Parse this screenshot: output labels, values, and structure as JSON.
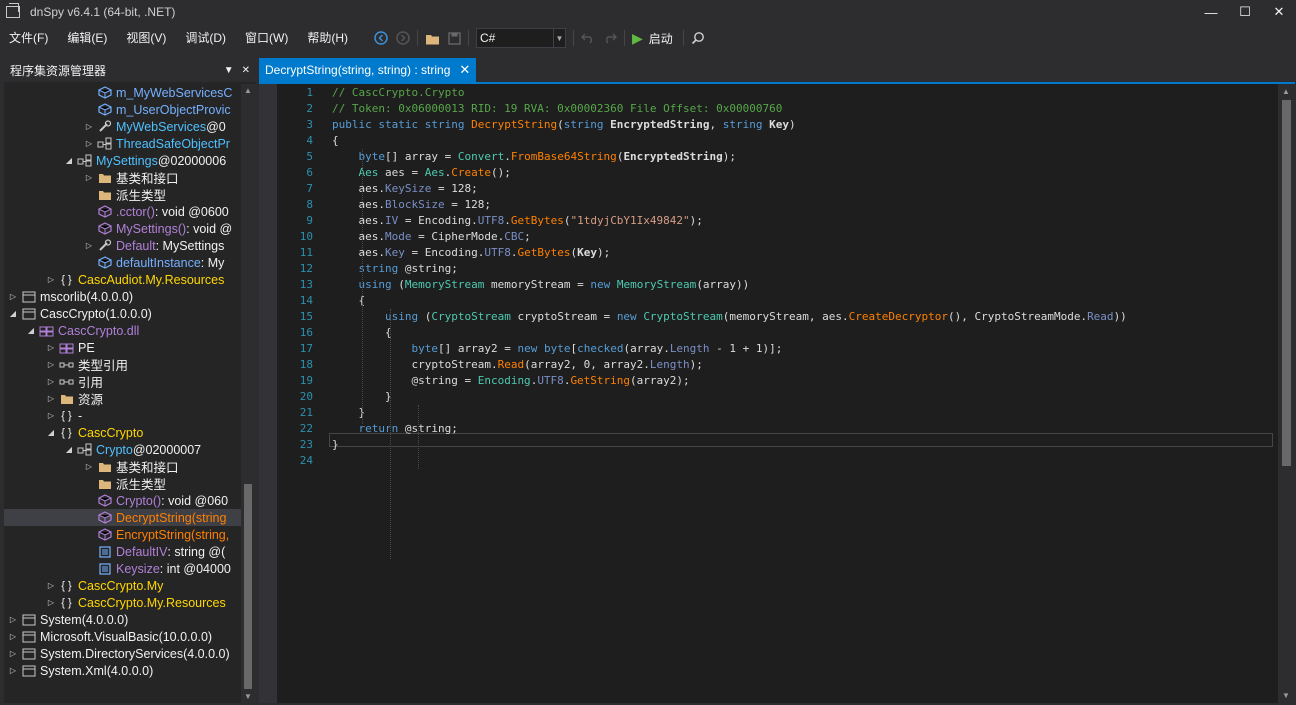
{
  "window": {
    "title": "dnSpy v6.4.1 (64-bit, .NET)",
    "minimize": "—",
    "maximize": "☐",
    "close": "✕"
  },
  "menu": [
    "文件(F)",
    "编辑(E)",
    "视图(V)",
    "调试(D)",
    "窗口(W)",
    "帮助(H)"
  ],
  "toolbar": {
    "language": "C#",
    "start_label": "启动"
  },
  "explorer": {
    "title": "程序集资源管理器",
    "rows": [
      {
        "label": "m_MyWebServicesC",
        "suffix": "",
        "color": "#75b0ff"
      },
      {
        "label": "m_UserObjectProvic",
        "suffix": "",
        "color": "#75b0ff"
      },
      {
        "label": "MyWebServices",
        "suffix": " @0",
        "color": "#4fc1ff"
      },
      {
        "label": "ThreadSafeObjectPr",
        "suffix": "",
        "color": "#4fc1ff"
      },
      {
        "label": "MySettings",
        "suffix": " @02000006",
        "color": "#4fc1ff"
      },
      {
        "label": "基类和接口",
        "suffix": "",
        "color": "#f1f1f1"
      },
      {
        "label": "派生类型",
        "suffix": "",
        "color": "#f1f1f1"
      },
      {
        "label": ".cctor()",
        "suffix": " : void @0600",
        "color": "#b180d7"
      },
      {
        "label": "MySettings()",
        "suffix": " : void @",
        "color": "#b180d7"
      },
      {
        "label": "Default",
        "suffix": " : MySettings",
        "color": "#b180d7"
      },
      {
        "label": "defaultInstance",
        "suffix": " : My",
        "color": "#75b0ff"
      },
      {
        "label": "CascAudiot.My.Resources",
        "suffix": "",
        "color": "#ffd700"
      },
      {
        "label": "mscorlib",
        "suffix": " (4.0.0.0)",
        "color": "#f1f1f1"
      },
      {
        "label": "CascCrypto",
        "suffix": " (1.0.0.0)",
        "color": "#f1f1f1"
      },
      {
        "label": "CascCrypto.dll",
        "suffix": "",
        "color": "#b180d7"
      },
      {
        "label": "PE",
        "suffix": "",
        "color": "#f1f1f1"
      },
      {
        "label": "类型引用",
        "suffix": "",
        "color": "#f1f1f1"
      },
      {
        "label": "引用",
        "suffix": "",
        "color": "#f1f1f1"
      },
      {
        "label": "资源",
        "suffix": "",
        "color": "#f1f1f1"
      },
      {
        "label": "-",
        "suffix": "",
        "color": "#f1f1f1"
      },
      {
        "label": "CascCrypto",
        "suffix": "",
        "color": "#ffd700"
      },
      {
        "label": "Crypto",
        "suffix": " @02000007",
        "color": "#4fc1ff"
      },
      {
        "label": "基类和接口",
        "suffix": "",
        "color": "#f1f1f1"
      },
      {
        "label": "派生类型",
        "suffix": "",
        "color": "#f1f1f1"
      },
      {
        "label": "Crypto()",
        "suffix": " : void @060",
        "color": "#b180d7"
      },
      {
        "label": "DecryptString",
        "suffix": "(string",
        "color": "#ff8000"
      },
      {
        "label": "EncryptString",
        "suffix": "(string,",
        "color": "#ff8000"
      },
      {
        "label": "DefaultIV",
        "suffix": " : string @(",
        "color": "#b180d7"
      },
      {
        "label": "Keysize",
        "suffix": " : int @04000",
        "color": "#b180d7"
      },
      {
        "label": "CascCrypto.My",
        "suffix": "",
        "color": "#ffd700"
      },
      {
        "label": "CascCrypto.My.Resources",
        "suffix": "",
        "color": "#ffd700"
      },
      {
        "label": "System",
        "suffix": " (4.0.0.0)",
        "color": "#f1f1f1"
      },
      {
        "label": "Microsoft.VisualBasic",
        "suffix": " (10.0.0.0)",
        "color": "#f1f1f1"
      },
      {
        "label": "System.DirectoryServices",
        "suffix": " (4.0.0.0)",
        "color": "#f1f1f1"
      },
      {
        "label": "System.Xml",
        "suffix": " (4.0.0.0)",
        "color": "#f1f1f1"
      }
    ]
  },
  "editor": {
    "tab_title": "DecryptString(string, string) : string",
    "line_numbers": [
      "1",
      "2",
      "3",
      "4",
      "5",
      "6",
      "7",
      "8",
      "9",
      "10",
      "11",
      "12",
      "13",
      "14",
      "15",
      "16",
      "17",
      "18",
      "19",
      "20",
      "21",
      "22",
      "23",
      "24"
    ],
    "lines": [
      [
        [
          "// CascCrypto.Crypto",
          "cmt"
        ]
      ],
      [
        [
          "// Token: 0x06000013 RID: 19 RVA: 0x00002360 File Offset: 0x00000760",
          "cmt"
        ]
      ],
      [
        [
          "public static string ",
          "kw"
        ],
        [
          "DecryptString",
          "meth"
        ],
        [
          "(",
          "par"
        ],
        [
          "string ",
          "kw"
        ],
        [
          "EncryptedString",
          "bold"
        ],
        [
          ", ",
          "par"
        ],
        [
          "string ",
          "kw"
        ],
        [
          "Key",
          "bold"
        ],
        [
          ")",
          "par"
        ]
      ],
      [
        [
          "{",
          "par"
        ]
      ],
      [
        [
          "    ",
          "par"
        ],
        [
          "byte",
          "kw"
        ],
        [
          "[] array = ",
          "par"
        ],
        [
          "Convert",
          "type"
        ],
        [
          ".",
          "par"
        ],
        [
          "FromBase64String",
          "meth"
        ],
        [
          "(",
          "par"
        ],
        [
          "EncryptedString",
          "bold"
        ],
        [
          ");",
          "par"
        ]
      ],
      [
        [
          "    ",
          "par"
        ],
        [
          "Aes",
          "type"
        ],
        [
          " aes = ",
          "par"
        ],
        [
          "Aes",
          "type"
        ],
        [
          ".",
          "par"
        ],
        [
          "Create",
          "meth"
        ],
        [
          "();",
          "par"
        ]
      ],
      [
        [
          "    aes.",
          "par"
        ],
        [
          "KeySize",
          "prop"
        ],
        [
          " = 128;",
          "par"
        ]
      ],
      [
        [
          "    aes.",
          "par"
        ],
        [
          "BlockSize",
          "prop"
        ],
        [
          " = 128;",
          "par"
        ]
      ],
      [
        [
          "    aes.",
          "par"
        ],
        [
          "IV",
          "prop"
        ],
        [
          " = Encoding.",
          "par"
        ],
        [
          "UTF8",
          "prop"
        ],
        [
          ".",
          "par"
        ],
        [
          "GetBytes",
          "meth"
        ],
        [
          "(",
          "par"
        ],
        [
          "\"1tdyjCbY1Ix49842\"",
          "str"
        ],
        [
          ");",
          "par"
        ]
      ],
      [
        [
          "    aes.",
          "par"
        ],
        [
          "Mode",
          "prop"
        ],
        [
          " = CipherMode.",
          "par"
        ],
        [
          "CBC",
          "prop"
        ],
        [
          ";",
          "par"
        ]
      ],
      [
        [
          "    aes.",
          "par"
        ],
        [
          "Key",
          "prop"
        ],
        [
          " = Encoding.",
          "par"
        ],
        [
          "UTF8",
          "prop"
        ],
        [
          ".",
          "par"
        ],
        [
          "GetBytes",
          "meth"
        ],
        [
          "(",
          "par"
        ],
        [
          "Key",
          "bold"
        ],
        [
          ");",
          "par"
        ]
      ],
      [
        [
          "    ",
          "par"
        ],
        [
          "string",
          "kw"
        ],
        [
          " @string;",
          "par"
        ]
      ],
      [
        [
          "    ",
          "par"
        ],
        [
          "using",
          "kw"
        ],
        [
          " (",
          "par"
        ],
        [
          "MemoryStream",
          "type"
        ],
        [
          " memoryStream = ",
          "par"
        ],
        [
          "new ",
          "kw"
        ],
        [
          "MemoryStream",
          "type"
        ],
        [
          "(array))",
          "par"
        ]
      ],
      [
        [
          "    {",
          "par"
        ]
      ],
      [
        [
          "        ",
          "par"
        ],
        [
          "using",
          "kw"
        ],
        [
          " (",
          "par"
        ],
        [
          "CryptoStream",
          "type"
        ],
        [
          " cryptoStream = ",
          "par"
        ],
        [
          "new ",
          "kw"
        ],
        [
          "CryptoStream",
          "type"
        ],
        [
          "(memoryStream, aes.",
          "par"
        ],
        [
          "CreateDecryptor",
          "meth"
        ],
        [
          "(), CryptoStreamMode.",
          "par"
        ],
        [
          "Read",
          "prop"
        ],
        [
          "))",
          "par"
        ]
      ],
      [
        [
          "        {",
          "par"
        ]
      ],
      [
        [
          "            ",
          "par"
        ],
        [
          "byte",
          "kw"
        ],
        [
          "[] array2 = ",
          "par"
        ],
        [
          "new ",
          "kw"
        ],
        [
          "byte",
          "kw"
        ],
        [
          "[",
          "par"
        ],
        [
          "checked",
          "kw"
        ],
        [
          "(array.",
          "par"
        ],
        [
          "Length",
          "prop"
        ],
        [
          " - 1 + 1)];",
          "par"
        ]
      ],
      [
        [
          "            cryptoStream.",
          "par"
        ],
        [
          "Read",
          "meth"
        ],
        [
          "(array2, 0, array2.",
          "par"
        ],
        [
          "Length",
          "prop"
        ],
        [
          ");",
          "par"
        ]
      ],
      [
        [
          "            @string = ",
          "par"
        ],
        [
          "Encoding",
          "type"
        ],
        [
          ".",
          "par"
        ],
        [
          "UTF8",
          "prop"
        ],
        [
          ".",
          "par"
        ],
        [
          "GetString",
          "meth"
        ],
        [
          "(array2);",
          "par"
        ]
      ],
      [
        [
          "        }",
          "par"
        ]
      ],
      [
        [
          "    }",
          "par"
        ]
      ],
      [
        [
          "    ",
          "par"
        ],
        [
          "return",
          "kw"
        ],
        [
          " @string;",
          "par"
        ]
      ],
      [
        [
          "}",
          "par"
        ]
      ],
      [
        [
          "",
          "par"
        ]
      ]
    ]
  },
  "colors": {
    "accent": "#007acc",
    "background": "#1e1e1e",
    "chrome": "#2d2d30",
    "comment": "#57a64a",
    "keyword": "#569cd6",
    "type": "#4ec9b0",
    "method": "#ff8000",
    "string": "#d69d85",
    "line_number": "#2b91af"
  }
}
